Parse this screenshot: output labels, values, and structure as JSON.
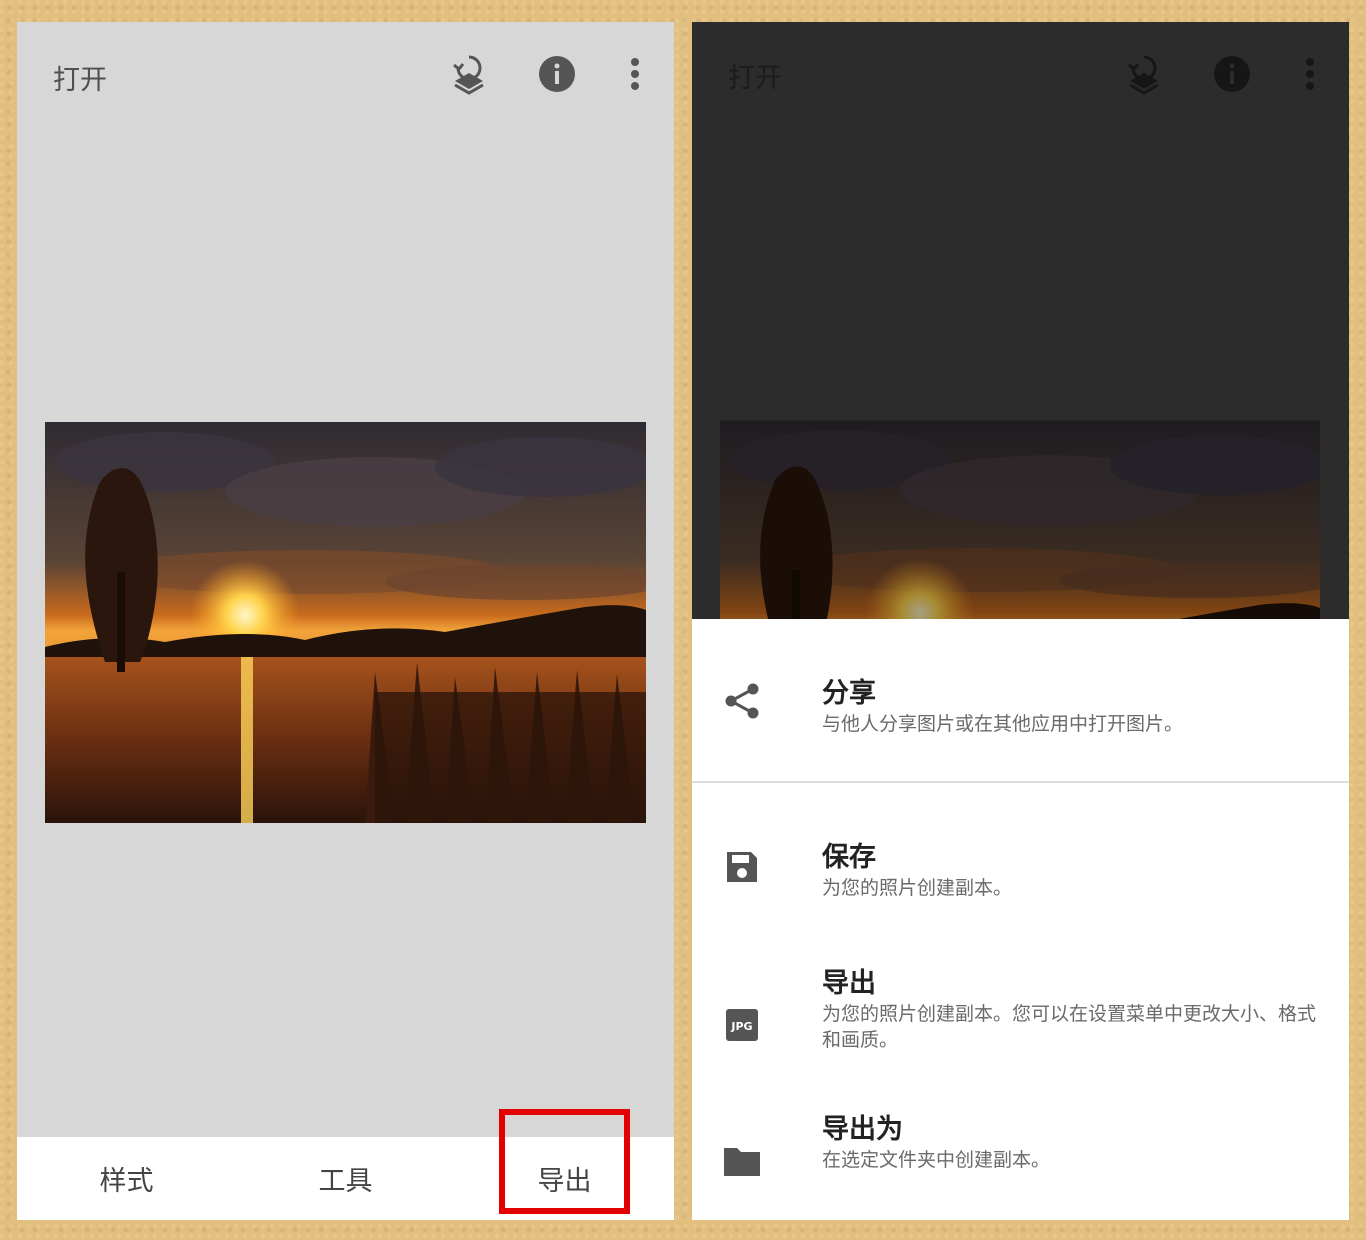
{
  "left_screen": {
    "topbar": {
      "open_label": "打开",
      "icons": [
        "layers-undo-icon",
        "info-icon",
        "more-vert-icon"
      ]
    },
    "photo": {
      "subject": "sunset over lake"
    },
    "bottom_nav": {
      "tab_styles": "样式",
      "tab_tools": "工具",
      "tab_export": "导出"
    },
    "highlight_color": "#e30000"
  },
  "right_screen": {
    "topbar": {
      "open_label": "打开",
      "icons": [
        "layers-undo-icon",
        "info-icon",
        "more-vert-icon"
      ]
    },
    "sheet": {
      "items": [
        {
          "icon": "share-icon",
          "title": "分享",
          "desc": "与他人分享图片或在其他应用中打开图片。"
        },
        {
          "icon": "save-icon",
          "title": "保存",
          "desc": "为您的照片创建副本。"
        },
        {
          "icon": "jpg-icon",
          "icon_text": "JPG",
          "title": "导出",
          "desc": "为您的照片创建副本。您可以在设置菜单中更改大小、格式和画质。"
        },
        {
          "icon": "folder-icon",
          "title": "导出为",
          "desc": "在选定文件夹中创建副本。"
        }
      ]
    }
  }
}
